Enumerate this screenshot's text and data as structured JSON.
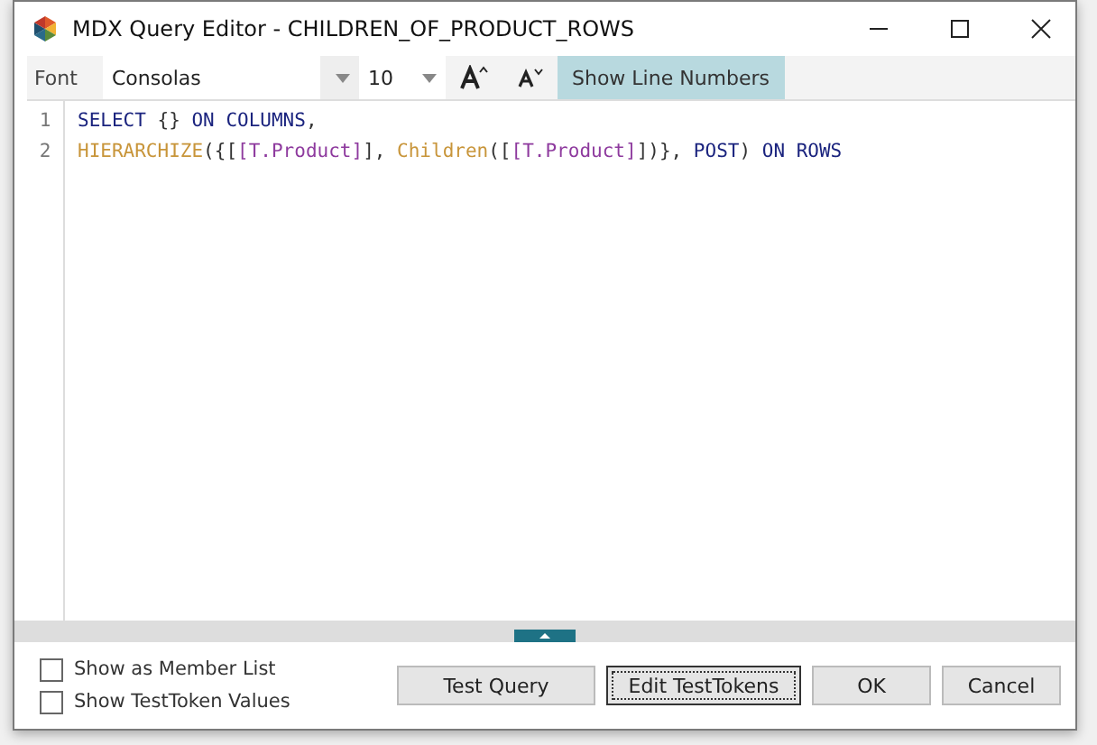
{
  "window": {
    "title": "MDX Query Editor - CHILDREN_OF_PRODUCT_ROWS"
  },
  "toolbar": {
    "font_label": "Font",
    "font_name": "Consolas",
    "font_size": "10",
    "show_line_numbers": {
      "label": "Show Line Numbers",
      "selected": true
    }
  },
  "editor": {
    "lines": [
      {
        "number": "1",
        "tokens": [
          {
            "kind": "keyword",
            "text": "SELECT"
          },
          {
            "kind": "plain",
            "text": " {} "
          },
          {
            "kind": "keyword",
            "text": "ON COLUMNS"
          },
          {
            "kind": "plain",
            "text": ","
          }
        ]
      },
      {
        "number": "2",
        "tokens": [
          {
            "kind": "function",
            "text": "HIERARCHIZE"
          },
          {
            "kind": "plain",
            "text": "({["
          },
          {
            "kind": "member",
            "text": "[T.Product]"
          },
          {
            "kind": "plain",
            "text": "], "
          },
          {
            "kind": "function",
            "text": "Children"
          },
          {
            "kind": "plain",
            "text": "(["
          },
          {
            "kind": "member",
            "text": "[T.Product]"
          },
          {
            "kind": "plain",
            "text": "])}, "
          },
          {
            "kind": "keyword",
            "text": "POST"
          },
          {
            "kind": "plain",
            "text": ") "
          },
          {
            "kind": "keyword",
            "text": "ON ROWS"
          }
        ]
      }
    ]
  },
  "options": [
    {
      "label": "Show as Member List",
      "checked": false
    },
    {
      "label": "Show TestToken Values",
      "checked": false
    }
  ],
  "buttons": [
    {
      "label": "Test Query",
      "focused": false
    },
    {
      "label": "Edit TestTokens",
      "focused": true
    },
    {
      "label": "OK",
      "focused": false
    },
    {
      "label": "Cancel",
      "focused": false
    }
  ]
}
